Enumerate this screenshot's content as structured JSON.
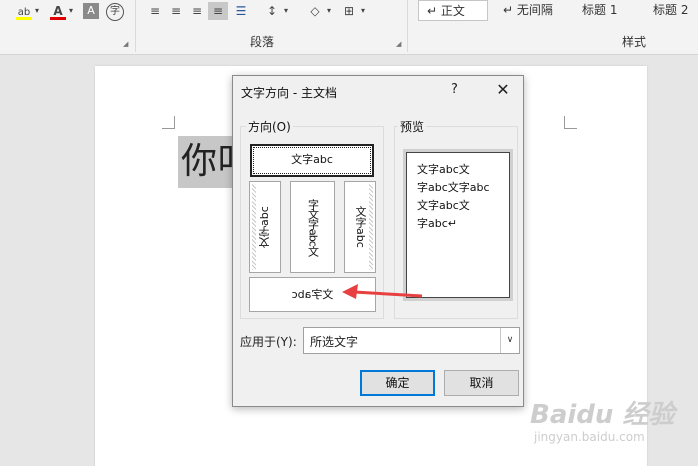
{
  "ribbon": {
    "font_tools": {
      "highlight_text": "ab",
      "font_color_text": "A",
      "char_shading_text": "A",
      "phonetic_text": "字",
      "highlight_color": "#ffff00",
      "font_color": "#e00000"
    },
    "paragraph_group_label": "段落",
    "styles_group_label": "样式",
    "styles": [
      "↵ 正文",
      "↵ 无间隔",
      "标题 1",
      "标题 2"
    ]
  },
  "document": {
    "text": "你叫"
  },
  "dialog": {
    "title": "文字方向 - 主文档",
    "help": "?",
    "close": "✕",
    "orientation_label": "方向(O)",
    "preview_label": "预览",
    "options": {
      "horizontal": "文字abc",
      "vertical_rotated_90": "文字abc",
      "vertical_stacked": "字文字abc文",
      "vertical_rotated_270": "文字abc",
      "horizontal_flipped": "文字abc"
    },
    "preview_lines": [
      "文字abc文",
      "字abc文字abc",
      "文字abc文",
      "字abc↵"
    ],
    "apply_to_label": "应用于(Y):",
    "apply_to_value": "所选文字",
    "ok_label": "确定",
    "cancel_label": "取消"
  },
  "watermark": {
    "brand": "Baidu 经验",
    "url": "jingyan.baidu.com"
  },
  "colors": {
    "annotation_arrow": "#e84040",
    "default_button_border": "#0078d7"
  }
}
